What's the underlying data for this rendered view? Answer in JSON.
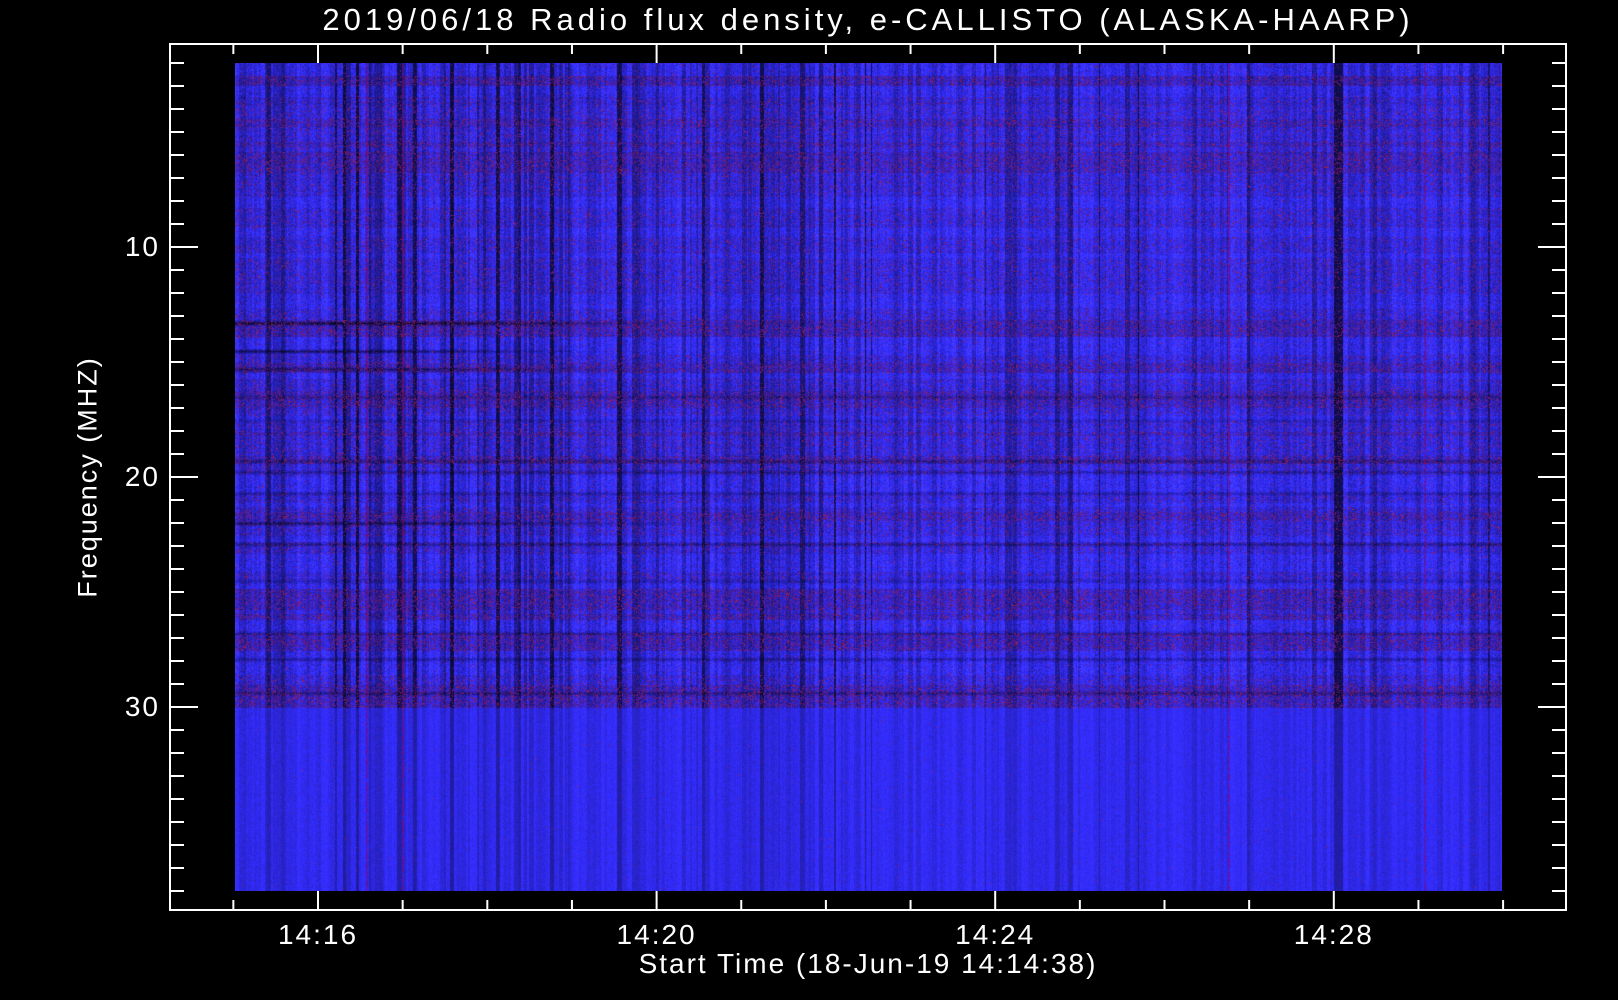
{
  "page": {
    "background": "#000000",
    "text_color": "#ffffff"
  },
  "chart_data": {
    "type": "heatmap",
    "subtype": "radio-spectrogram",
    "title": "2019/06/18  Radio flux density, e-CALLISTO (ALASKA-HAARP)",
    "date": "2019/06/18",
    "instrument": "e-CALLISTO",
    "station": "ALASKA-HAARP",
    "xlabel": "Start Time (18-Jun-19 14:14:38)",
    "ylabel": "Frequency (MHZ)",
    "start_time": "14:14:38",
    "x_axis": {
      "unit": "time HH:MM",
      "major_ticks": [
        {
          "label": "14:16",
          "minute": 16
        },
        {
          "label": "14:20",
          "minute": 20
        },
        {
          "label": "14:24",
          "minute": 24
        },
        {
          "label": "14:28",
          "minute": 28
        }
      ],
      "minor_tick_minutes": [
        15,
        16,
        17,
        18,
        19,
        20,
        21,
        22,
        23,
        24,
        25,
        26,
        27,
        28,
        29,
        30
      ],
      "axis_minute_range": [
        14.25,
        30.74
      ],
      "data_minute_range": [
        15.0,
        30.0
      ]
    },
    "y_axis": {
      "unit": "MHZ",
      "major_ticks": [
        10,
        20,
        30
      ],
      "minor_tick_mhz_step": 1,
      "minor_tick_mhz": [
        2,
        3,
        4,
        5,
        6,
        7,
        8,
        9,
        10,
        11,
        12,
        13,
        14,
        15,
        16,
        17,
        18,
        19,
        20,
        21,
        22,
        23,
        24,
        25,
        26,
        27,
        28,
        29,
        30,
        31,
        32,
        33,
        34,
        35,
        36,
        37,
        38
      ],
      "axis_mhz_range": [
        1.2,
        38.8
      ],
      "data_mhz_range": [
        2.0,
        38.0
      ],
      "direction": "increasing-downward"
    },
    "legend": "none",
    "grid": "off",
    "colormap": {
      "background": "#000000",
      "base_blue": "#2e28d8",
      "quiet_blue": "#2a22e6",
      "purple_noise": "#64209a",
      "dark_red_noise": "#871959",
      "red_speckle": "#c82320",
      "dark_streak": "#06062e",
      "frame": "#ffffff"
    },
    "features": {
      "description": "Broadband blue noise spectrogram: fine vertical per-column brightness striping, alternating horizontal strata of purple/red RFI speckle and cleaner blue, occasional near-black vertical dropouts and thin red vertical lines; smooth quiet blue region below ~30 MHz.",
      "quiet_below_mhz": 30,
      "dark_lines": [
        {
          "mhz": 13.3,
          "x_full_frac": 0.18,
          "x_fade_frac": 0.35,
          "alpha": 0.75
        },
        {
          "mhz": 14.5,
          "x_full_frac": 0.12,
          "x_fade_frac": 0.3,
          "alpha": 0.6
        },
        {
          "mhz": 15.3,
          "x_full_frac": 0.15,
          "x_fade_frac": 0.33,
          "alpha": 0.5
        },
        {
          "mhz": 16.5,
          "x_full_frac": 1.0,
          "x_fade_frac": 1.0,
          "alpha": 0.28
        },
        {
          "mhz": 17.5,
          "x_full_frac": 1.0,
          "x_fade_frac": 1.0,
          "alpha": 0.2
        },
        {
          "mhz": 19.3,
          "x_full_frac": 1.0,
          "x_fade_frac": 1.0,
          "alpha": 0.4
        },
        {
          "mhz": 19.8,
          "x_full_frac": 1.0,
          "x_fade_frac": 1.0,
          "alpha": 0.28
        },
        {
          "mhz": 20.7,
          "x_full_frac": 1.0,
          "x_fade_frac": 1.0,
          "alpha": 0.3
        },
        {
          "mhz": 22.0,
          "x_full_frac": 0.15,
          "x_fade_frac": 0.4,
          "alpha": 0.55
        },
        {
          "mhz": 22.9,
          "x_full_frac": 1.0,
          "x_fade_frac": 1.0,
          "alpha": 0.36
        },
        {
          "mhz": 24.5,
          "x_full_frac": 1.0,
          "x_fade_frac": 1.0,
          "alpha": 0.26
        },
        {
          "mhz": 26.8,
          "x_full_frac": 1.0,
          "x_fade_frac": 1.0,
          "alpha": 0.3
        },
        {
          "mhz": 27.9,
          "x_full_frac": 1.0,
          "x_fade_frac": 1.0,
          "alpha": 0.34
        },
        {
          "mhz": 29.4,
          "x_full_frac": 1.0,
          "x_fade_frac": 1.0,
          "alpha": 0.4
        }
      ]
    }
  }
}
